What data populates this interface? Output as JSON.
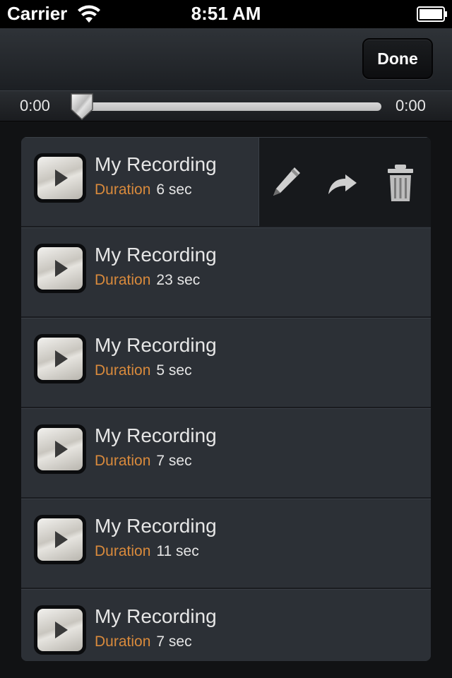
{
  "status_bar": {
    "carrier": "Carrier",
    "time": "8:51 AM"
  },
  "toolbar": {
    "done_label": "Done"
  },
  "player": {
    "current_time": "0:00",
    "total_time": "0:00",
    "progress": 0
  },
  "recordings": [
    {
      "title": "My Recording",
      "duration_label": "Duration",
      "duration_value": "6 sec"
    },
    {
      "title": "My Recording",
      "duration_label": "Duration",
      "duration_value": "23 sec"
    },
    {
      "title": "My Recording",
      "duration_label": "Duration",
      "duration_value": "5 sec"
    },
    {
      "title": "My Recording",
      "duration_label": "Duration",
      "duration_value": "7 sec"
    },
    {
      "title": "My Recording",
      "duration_label": "Duration",
      "duration_value": "11 sec"
    },
    {
      "title": "My Recording",
      "duration_label": "Duration",
      "duration_value": "7 sec"
    }
  ],
  "row_actions": [
    "pencil-icon",
    "share-arrow-icon",
    "trash-icon"
  ],
  "colors": {
    "accent": "#d98a3c",
    "row_background": "#2c3036",
    "action_panel": "#17191c"
  }
}
